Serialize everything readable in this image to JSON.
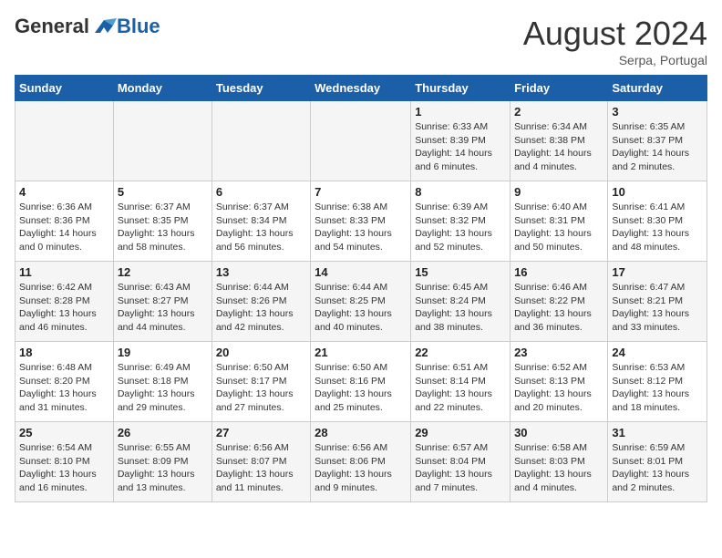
{
  "header": {
    "logo_general": "General",
    "logo_blue": "Blue",
    "month_year": "August 2024",
    "location": "Serpa, Portugal"
  },
  "weekdays": [
    "Sunday",
    "Monday",
    "Tuesday",
    "Wednesday",
    "Thursday",
    "Friday",
    "Saturday"
  ],
  "weeks": [
    [
      {
        "day": "",
        "info": ""
      },
      {
        "day": "",
        "info": ""
      },
      {
        "day": "",
        "info": ""
      },
      {
        "day": "",
        "info": ""
      },
      {
        "day": "1",
        "info": "Sunrise: 6:33 AM\nSunset: 8:39 PM\nDaylight: 14 hours\nand 6 minutes."
      },
      {
        "day": "2",
        "info": "Sunrise: 6:34 AM\nSunset: 8:38 PM\nDaylight: 14 hours\nand 4 minutes."
      },
      {
        "day": "3",
        "info": "Sunrise: 6:35 AM\nSunset: 8:37 PM\nDaylight: 14 hours\nand 2 minutes."
      }
    ],
    [
      {
        "day": "4",
        "info": "Sunrise: 6:36 AM\nSunset: 8:36 PM\nDaylight: 14 hours\nand 0 minutes."
      },
      {
        "day": "5",
        "info": "Sunrise: 6:37 AM\nSunset: 8:35 PM\nDaylight: 13 hours\nand 58 minutes."
      },
      {
        "day": "6",
        "info": "Sunrise: 6:37 AM\nSunset: 8:34 PM\nDaylight: 13 hours\nand 56 minutes."
      },
      {
        "day": "7",
        "info": "Sunrise: 6:38 AM\nSunset: 8:33 PM\nDaylight: 13 hours\nand 54 minutes."
      },
      {
        "day": "8",
        "info": "Sunrise: 6:39 AM\nSunset: 8:32 PM\nDaylight: 13 hours\nand 52 minutes."
      },
      {
        "day": "9",
        "info": "Sunrise: 6:40 AM\nSunset: 8:31 PM\nDaylight: 13 hours\nand 50 minutes."
      },
      {
        "day": "10",
        "info": "Sunrise: 6:41 AM\nSunset: 8:30 PM\nDaylight: 13 hours\nand 48 minutes."
      }
    ],
    [
      {
        "day": "11",
        "info": "Sunrise: 6:42 AM\nSunset: 8:28 PM\nDaylight: 13 hours\nand 46 minutes."
      },
      {
        "day": "12",
        "info": "Sunrise: 6:43 AM\nSunset: 8:27 PM\nDaylight: 13 hours\nand 44 minutes."
      },
      {
        "day": "13",
        "info": "Sunrise: 6:44 AM\nSunset: 8:26 PM\nDaylight: 13 hours\nand 42 minutes."
      },
      {
        "day": "14",
        "info": "Sunrise: 6:44 AM\nSunset: 8:25 PM\nDaylight: 13 hours\nand 40 minutes."
      },
      {
        "day": "15",
        "info": "Sunrise: 6:45 AM\nSunset: 8:24 PM\nDaylight: 13 hours\nand 38 minutes."
      },
      {
        "day": "16",
        "info": "Sunrise: 6:46 AM\nSunset: 8:22 PM\nDaylight: 13 hours\nand 36 minutes."
      },
      {
        "day": "17",
        "info": "Sunrise: 6:47 AM\nSunset: 8:21 PM\nDaylight: 13 hours\nand 33 minutes."
      }
    ],
    [
      {
        "day": "18",
        "info": "Sunrise: 6:48 AM\nSunset: 8:20 PM\nDaylight: 13 hours\nand 31 minutes."
      },
      {
        "day": "19",
        "info": "Sunrise: 6:49 AM\nSunset: 8:18 PM\nDaylight: 13 hours\nand 29 minutes."
      },
      {
        "day": "20",
        "info": "Sunrise: 6:50 AM\nSunset: 8:17 PM\nDaylight: 13 hours\nand 27 minutes."
      },
      {
        "day": "21",
        "info": "Sunrise: 6:50 AM\nSunset: 8:16 PM\nDaylight: 13 hours\nand 25 minutes."
      },
      {
        "day": "22",
        "info": "Sunrise: 6:51 AM\nSunset: 8:14 PM\nDaylight: 13 hours\nand 22 minutes."
      },
      {
        "day": "23",
        "info": "Sunrise: 6:52 AM\nSunset: 8:13 PM\nDaylight: 13 hours\nand 20 minutes."
      },
      {
        "day": "24",
        "info": "Sunrise: 6:53 AM\nSunset: 8:12 PM\nDaylight: 13 hours\nand 18 minutes."
      }
    ],
    [
      {
        "day": "25",
        "info": "Sunrise: 6:54 AM\nSunset: 8:10 PM\nDaylight: 13 hours\nand 16 minutes."
      },
      {
        "day": "26",
        "info": "Sunrise: 6:55 AM\nSunset: 8:09 PM\nDaylight: 13 hours\nand 13 minutes."
      },
      {
        "day": "27",
        "info": "Sunrise: 6:56 AM\nSunset: 8:07 PM\nDaylight: 13 hours\nand 11 minutes."
      },
      {
        "day": "28",
        "info": "Sunrise: 6:56 AM\nSunset: 8:06 PM\nDaylight: 13 hours\nand 9 minutes."
      },
      {
        "day": "29",
        "info": "Sunrise: 6:57 AM\nSunset: 8:04 PM\nDaylight: 13 hours\nand 7 minutes."
      },
      {
        "day": "30",
        "info": "Sunrise: 6:58 AM\nSunset: 8:03 PM\nDaylight: 13 hours\nand 4 minutes."
      },
      {
        "day": "31",
        "info": "Sunrise: 6:59 AM\nSunset: 8:01 PM\nDaylight: 13 hours\nand 2 minutes."
      }
    ]
  ]
}
